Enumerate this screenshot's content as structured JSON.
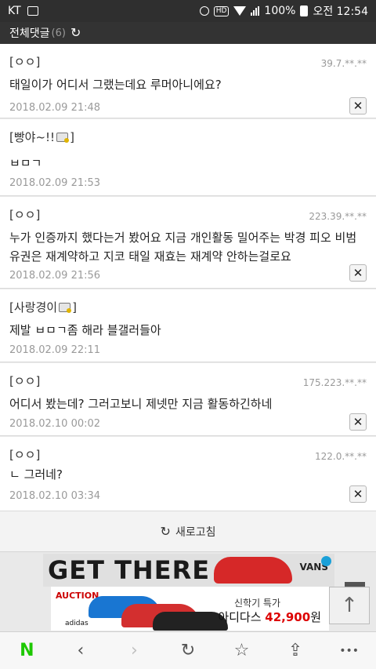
{
  "status_bar": {
    "carrier": "KT",
    "hd": "HD",
    "battery": "100%",
    "time": "오전 12:54"
  },
  "header": {
    "title": "전체댓글",
    "count": "(6)"
  },
  "comments": [
    {
      "author": "[ㅇㅇ]",
      "ip": "39.7.**.**",
      "body": "태일이가 어디서 그랬는데요 루머아니에요?",
      "date": "2018.02.09 21:48",
      "deletable": true
    },
    {
      "author": "[빵야~!!",
      "author_suffix": "]",
      "member": true,
      "body": "ㅂㅁㄱ",
      "date": "2018.02.09 21:53",
      "deletable": false
    },
    {
      "author": "[ㅇㅇ]",
      "ip": "223.39.**.**",
      "body": "누가 인증까지 했다는거 봤어요 지금 개인활동 밀어주는 박경 피오 비범 유권은 재계약하고 지코 태일 재효는 재계약 안하는걸로요",
      "date": "2018.02.09 21:56",
      "deletable": true
    },
    {
      "author": "[사랑경이",
      "author_suffix": "]",
      "member": true,
      "body": "제발 ㅂㅁㄱ좀 해라 블갤러들아",
      "date": "2018.02.09 22:11",
      "deletable": false
    },
    {
      "author": "[ㅇㅇ]",
      "ip": "175.223.**.**",
      "body": "어디서 봤는데? 그러고보니 제넷만 지금 활동하긴하네",
      "date": "2018.02.10 00:02",
      "deletable": true
    },
    {
      "author": "[ㅇㅇ]",
      "ip": "122.0.**.**",
      "body": "ㄴ 그러네?",
      "date": "2018.02.10 03:34",
      "deletable": true
    }
  ],
  "delete_label": "✕",
  "reload_label": "새로고침",
  "ads": {
    "banner_text": "GET THERE",
    "banner_brand": "VANS",
    "auction": "AUCTION.",
    "adidas": "adidas",
    "line1": "신학기 특가",
    "line2_prefix": "아디다스 ",
    "price": "42,900",
    "line2_suffix": "원"
  },
  "icons": {
    "refresh": "↻",
    "top_arrow": "↑",
    "back": "‹",
    "forward": "›",
    "share": "⇪",
    "more": "•••",
    "naver": "N",
    "bookmark": "☆"
  }
}
